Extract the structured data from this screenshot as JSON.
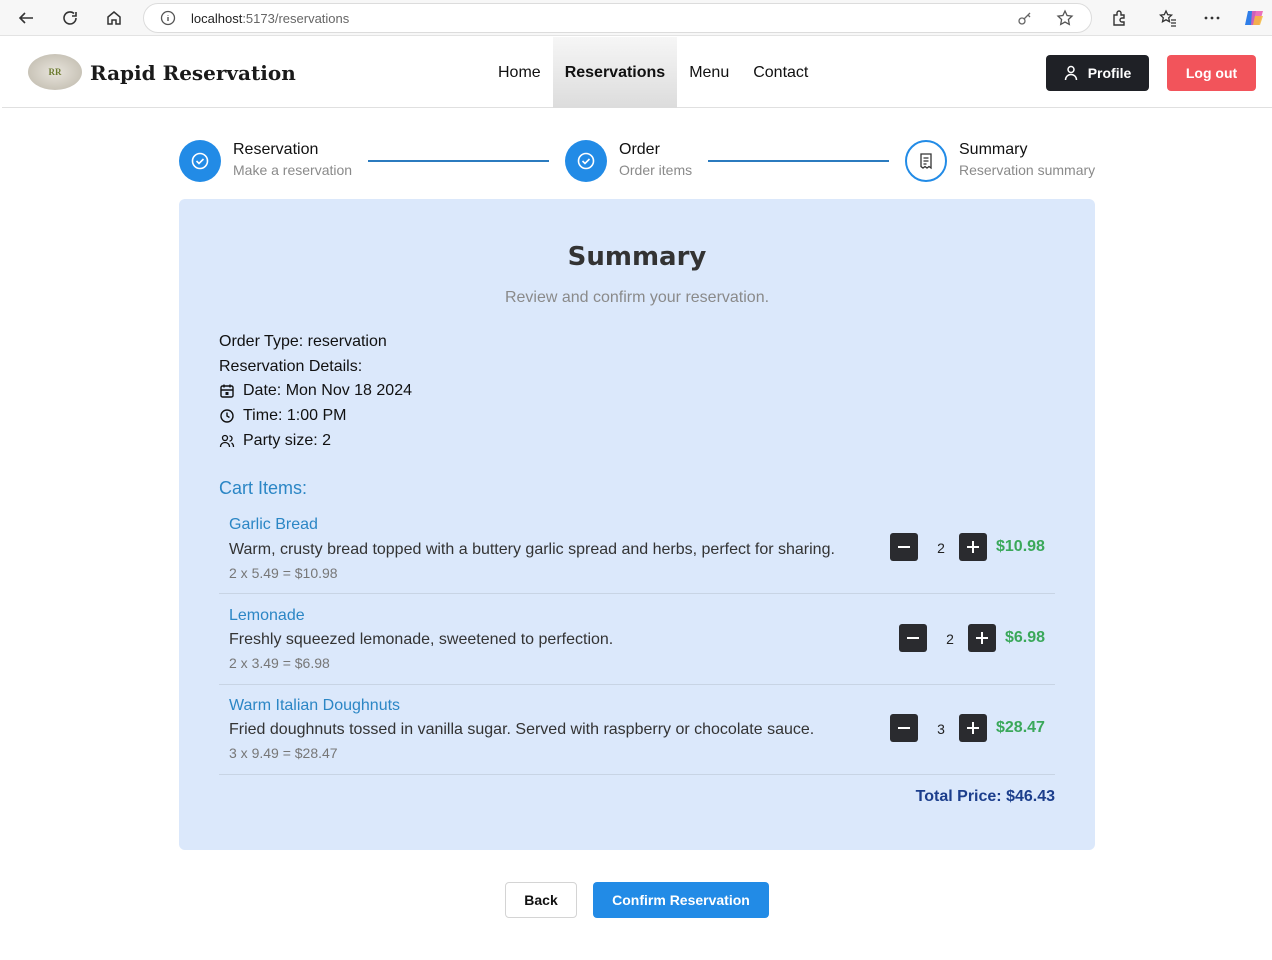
{
  "browser": {
    "url_host": "localhost",
    "url_path": ":5173/reservations"
  },
  "header": {
    "logo_text": "RR",
    "brand": "Rapid Reservation",
    "nav": [
      {
        "label": "Home",
        "active": false
      },
      {
        "label": "Reservations",
        "active": true
      },
      {
        "label": "Menu",
        "active": false
      },
      {
        "label": "Contact",
        "active": false
      }
    ],
    "profile_label": "Profile",
    "logout_label": "Log out"
  },
  "stepper": {
    "steps": [
      {
        "title": "Reservation",
        "subtitle": "Make a reservation",
        "state": "done"
      },
      {
        "title": "Order",
        "subtitle": "Order items",
        "state": "done"
      },
      {
        "title": "Summary",
        "subtitle": "Reservation summary",
        "state": "current"
      }
    ]
  },
  "summary": {
    "title": "Summary",
    "subtitle": "Review and confirm your reservation.",
    "order_type": "Order Type: reservation",
    "details_label": "Reservation Details:",
    "date": "Date: Mon Nov 18 2024",
    "time": "Time: 1:00 PM",
    "party": "Party size: 2",
    "cart_heading": "Cart Items:",
    "items": [
      {
        "name": "Garlic Bread",
        "description": "Warm, crusty bread topped with a buttery garlic spread and herbs, perfect for sharing.",
        "calc": "2 x 5.49 = $10.98",
        "qty": "2",
        "price": "$10.98"
      },
      {
        "name": "Lemonade",
        "description": "Freshly squeezed lemonade, sweetened to perfection.",
        "calc": "2 x 3.49 = $6.98",
        "qty": "2",
        "price": "$6.98"
      },
      {
        "name": "Warm Italian Doughnuts",
        "description": "Fried doughnuts tossed in vanilla sugar. Served with raspberry or chocolate sauce.",
        "calc": "3 x 9.49 = $28.47",
        "qty": "3",
        "price": "$28.47"
      }
    ],
    "total": "Total Price: $46.43"
  },
  "actions": {
    "back_label": "Back",
    "confirm_label": "Confirm Reservation"
  },
  "colors": {
    "accent": "#228be6",
    "card_bg": "#dbe8fb",
    "price_green": "#3aa85a",
    "logout_red": "#f2545b"
  }
}
